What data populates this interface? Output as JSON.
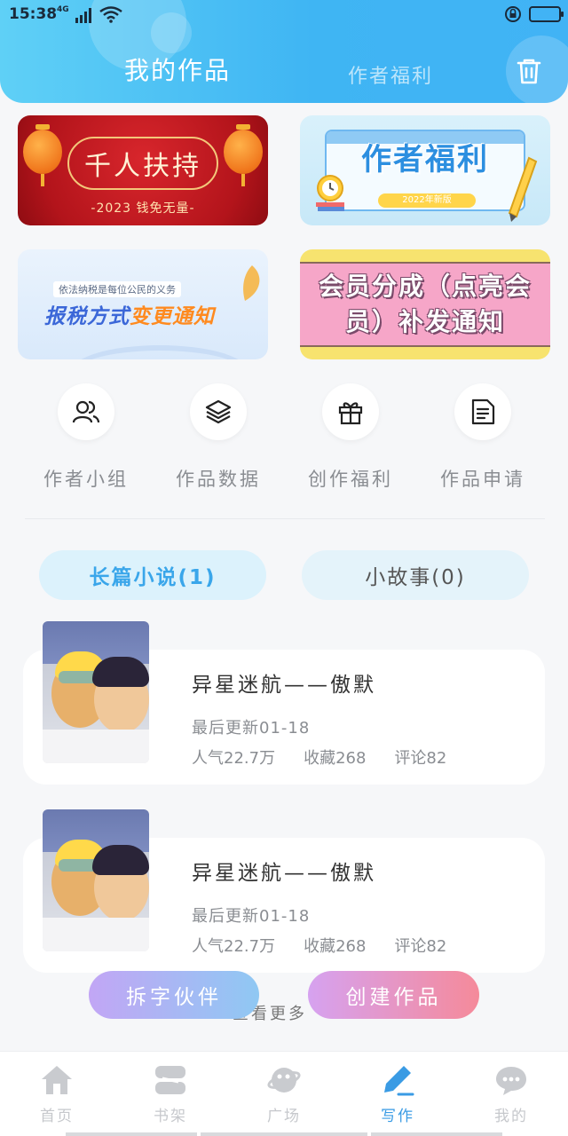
{
  "status_bar": {
    "time": "15:38",
    "network": "4G"
  },
  "header": {
    "tabs": [
      {
        "label": "我的作品",
        "active": true
      },
      {
        "label": "作者福利",
        "active": false
      }
    ],
    "trash_icon": "trash-icon"
  },
  "banners": [
    {
      "title": "千人扶持",
      "subtitle": "-2023 钱免无量-"
    },
    {
      "title": "作者福利",
      "badge": "2022年新版"
    },
    {
      "small": "依法纳税是每位公民的义务",
      "title_main": "报税方式",
      "title_highlight": "变更通知"
    },
    {
      "title": "会员分成（点亮会员）补发通知"
    }
  ],
  "quick_actions": [
    {
      "label": "作者小组",
      "icon": "users-icon"
    },
    {
      "label": "作品数据",
      "icon": "layers-icon"
    },
    {
      "label": "创作福利",
      "icon": "gift-icon"
    },
    {
      "label": "作品申请",
      "icon": "document-icon"
    }
  ],
  "category_tabs": [
    {
      "label": "长篇小说(1)",
      "active": true
    },
    {
      "label": "小故事(0)",
      "active": false
    }
  ],
  "works": [
    {
      "title": "异星迷航——傲默",
      "updated": "最后更新01-18",
      "popularity": "人气22.7万",
      "favorites": "收藏268",
      "comments": "评论82"
    },
    {
      "title": "异星迷航——傲默",
      "updated": "最后更新01-18",
      "popularity": "人气22.7万",
      "favorites": "收藏268",
      "comments": "评论82"
    }
  ],
  "more_text": "查看更多",
  "float_buttons": {
    "partner": "拆字伙伴",
    "create": "创建作品"
  },
  "bottom_nav": [
    {
      "label": "首页",
      "icon": "home-icon",
      "active": false
    },
    {
      "label": "书架",
      "icon": "bookshelf-icon",
      "active": false
    },
    {
      "label": "广场",
      "icon": "planet-icon",
      "active": false
    },
    {
      "label": "写作",
      "icon": "pen-icon",
      "active": true
    },
    {
      "label": "我的",
      "icon": "chat-bubble-icon",
      "active": false
    }
  ],
  "colors": {
    "accent": "#3a9be4",
    "header_start": "#5fd0f6",
    "header_end": "#41b3f5"
  }
}
